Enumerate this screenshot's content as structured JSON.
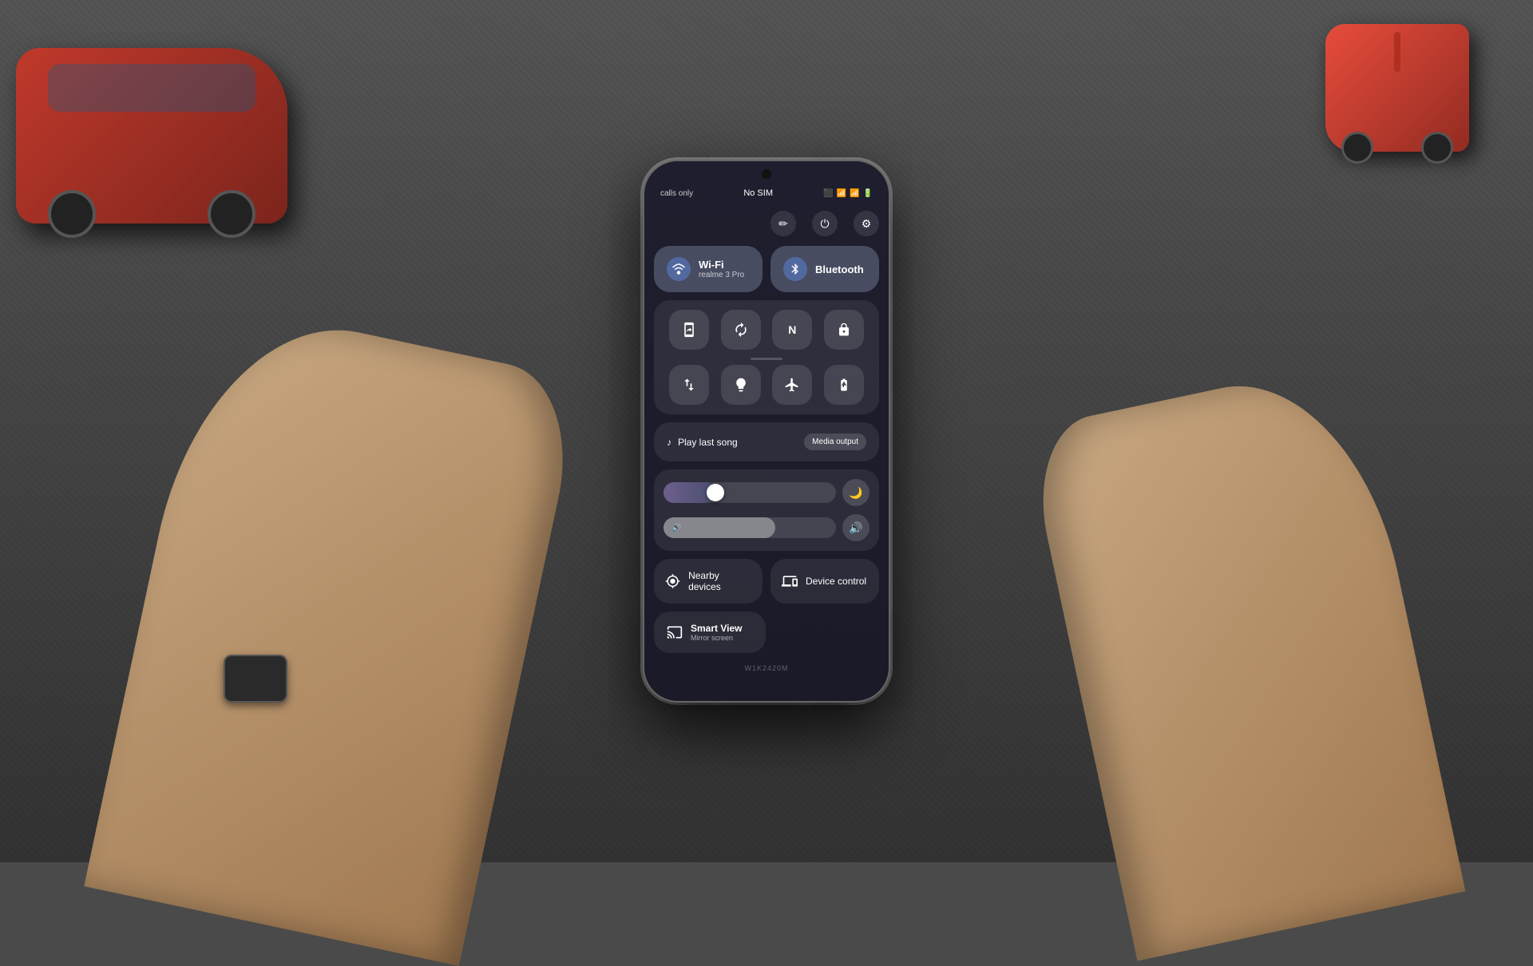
{
  "scene": {
    "bg_color": "#4a4a4a"
  },
  "status_bar": {
    "left": "calls only",
    "center": "No SIM",
    "battery": "🔋",
    "signal": "📶"
  },
  "quick_settings": {
    "top_icons": [
      {
        "name": "edit",
        "symbol": "✏️"
      },
      {
        "name": "power",
        "symbol": "⏻"
      },
      {
        "name": "settings",
        "symbol": "⚙"
      }
    ],
    "wifi_tile": {
      "title": "Wi-Fi",
      "subtitle": "realme 3 Pro",
      "icon": "📶",
      "active": true
    },
    "bluetooth_tile": {
      "title": "Bluetooth",
      "subtitle": "",
      "icon": "🔵",
      "active": true
    },
    "small_tiles_row1": [
      {
        "name": "screenshot",
        "symbol": "⊞",
        "active": false
      },
      {
        "name": "rotate",
        "symbol": "↻",
        "active": false
      },
      {
        "name": "nfc",
        "symbol": "N",
        "active": false
      },
      {
        "name": "lock",
        "symbol": "🔒",
        "active": false
      }
    ],
    "small_tiles_row2": [
      {
        "name": "data-transfer",
        "symbol": "⇅",
        "active": false
      },
      {
        "name": "flashlight",
        "symbol": "🔦",
        "active": false
      },
      {
        "name": "airplane",
        "symbol": "✈",
        "active": false
      },
      {
        "name": "battery-saver",
        "symbol": "🔋",
        "active": false
      }
    ],
    "media": {
      "icon": "♪",
      "label": "Play last song",
      "output_button": "Media output"
    },
    "brightness": {
      "level": 30,
      "icon": "🌙"
    },
    "volume": {
      "level": 65,
      "icon": "🔊"
    },
    "bottom_tiles": [
      {
        "name": "nearby-devices",
        "icon": "⊙",
        "label": "Nearby devices"
      },
      {
        "name": "device-control",
        "icon": "⊞",
        "label": "Device control"
      }
    ],
    "smart_view": {
      "icon": "⊙",
      "title": "Smart View",
      "subtitle": "Mirror screen"
    },
    "model_number": "W1K2420M"
  }
}
